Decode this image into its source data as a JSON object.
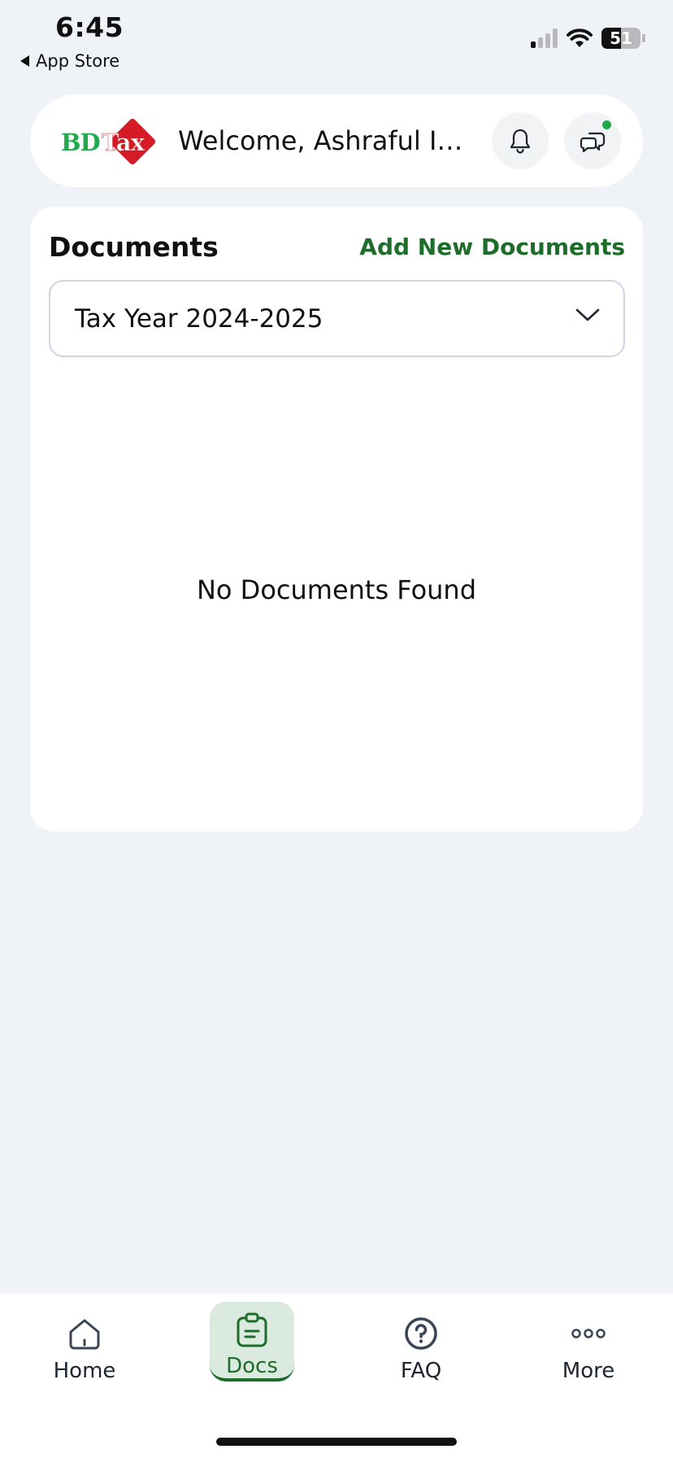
{
  "status_bar": {
    "time": "6:45",
    "back_label": "App Store",
    "battery_percent": "51",
    "battery_level": 0.51,
    "icons": [
      "cellular-signal-icon",
      "wifi-icon",
      "battery-icon"
    ]
  },
  "header": {
    "logo_bd": "BD",
    "logo_tax": "Tax",
    "welcome_text": "Welcome, Ashraful Isl...",
    "notification_icon": "bell-icon",
    "chat_icon": "chat-icon",
    "chat_badge_color": "#1fa64a"
  },
  "documents": {
    "title": "Documents",
    "add_link": "Add New Documents",
    "tax_year_select": {
      "selected": "Tax Year 2024-2025",
      "icon": "chevron-down-icon"
    },
    "empty_message": "No Documents Found"
  },
  "bottom_nav": {
    "items": [
      {
        "label": "Home",
        "icon": "home-icon",
        "active": false
      },
      {
        "label": "Docs",
        "icon": "clipboard-icon",
        "active": true
      },
      {
        "label": "FAQ",
        "icon": "question-icon",
        "active": false
      },
      {
        "label": "More",
        "icon": "more-dots-icon",
        "active": false
      }
    ]
  },
  "colors": {
    "accent_green": "#1d6c2a",
    "active_tab_bg": "#dbeadf",
    "logo_red": "#d51b26",
    "logo_green": "#1faa4b",
    "background": "#eff3f8"
  }
}
